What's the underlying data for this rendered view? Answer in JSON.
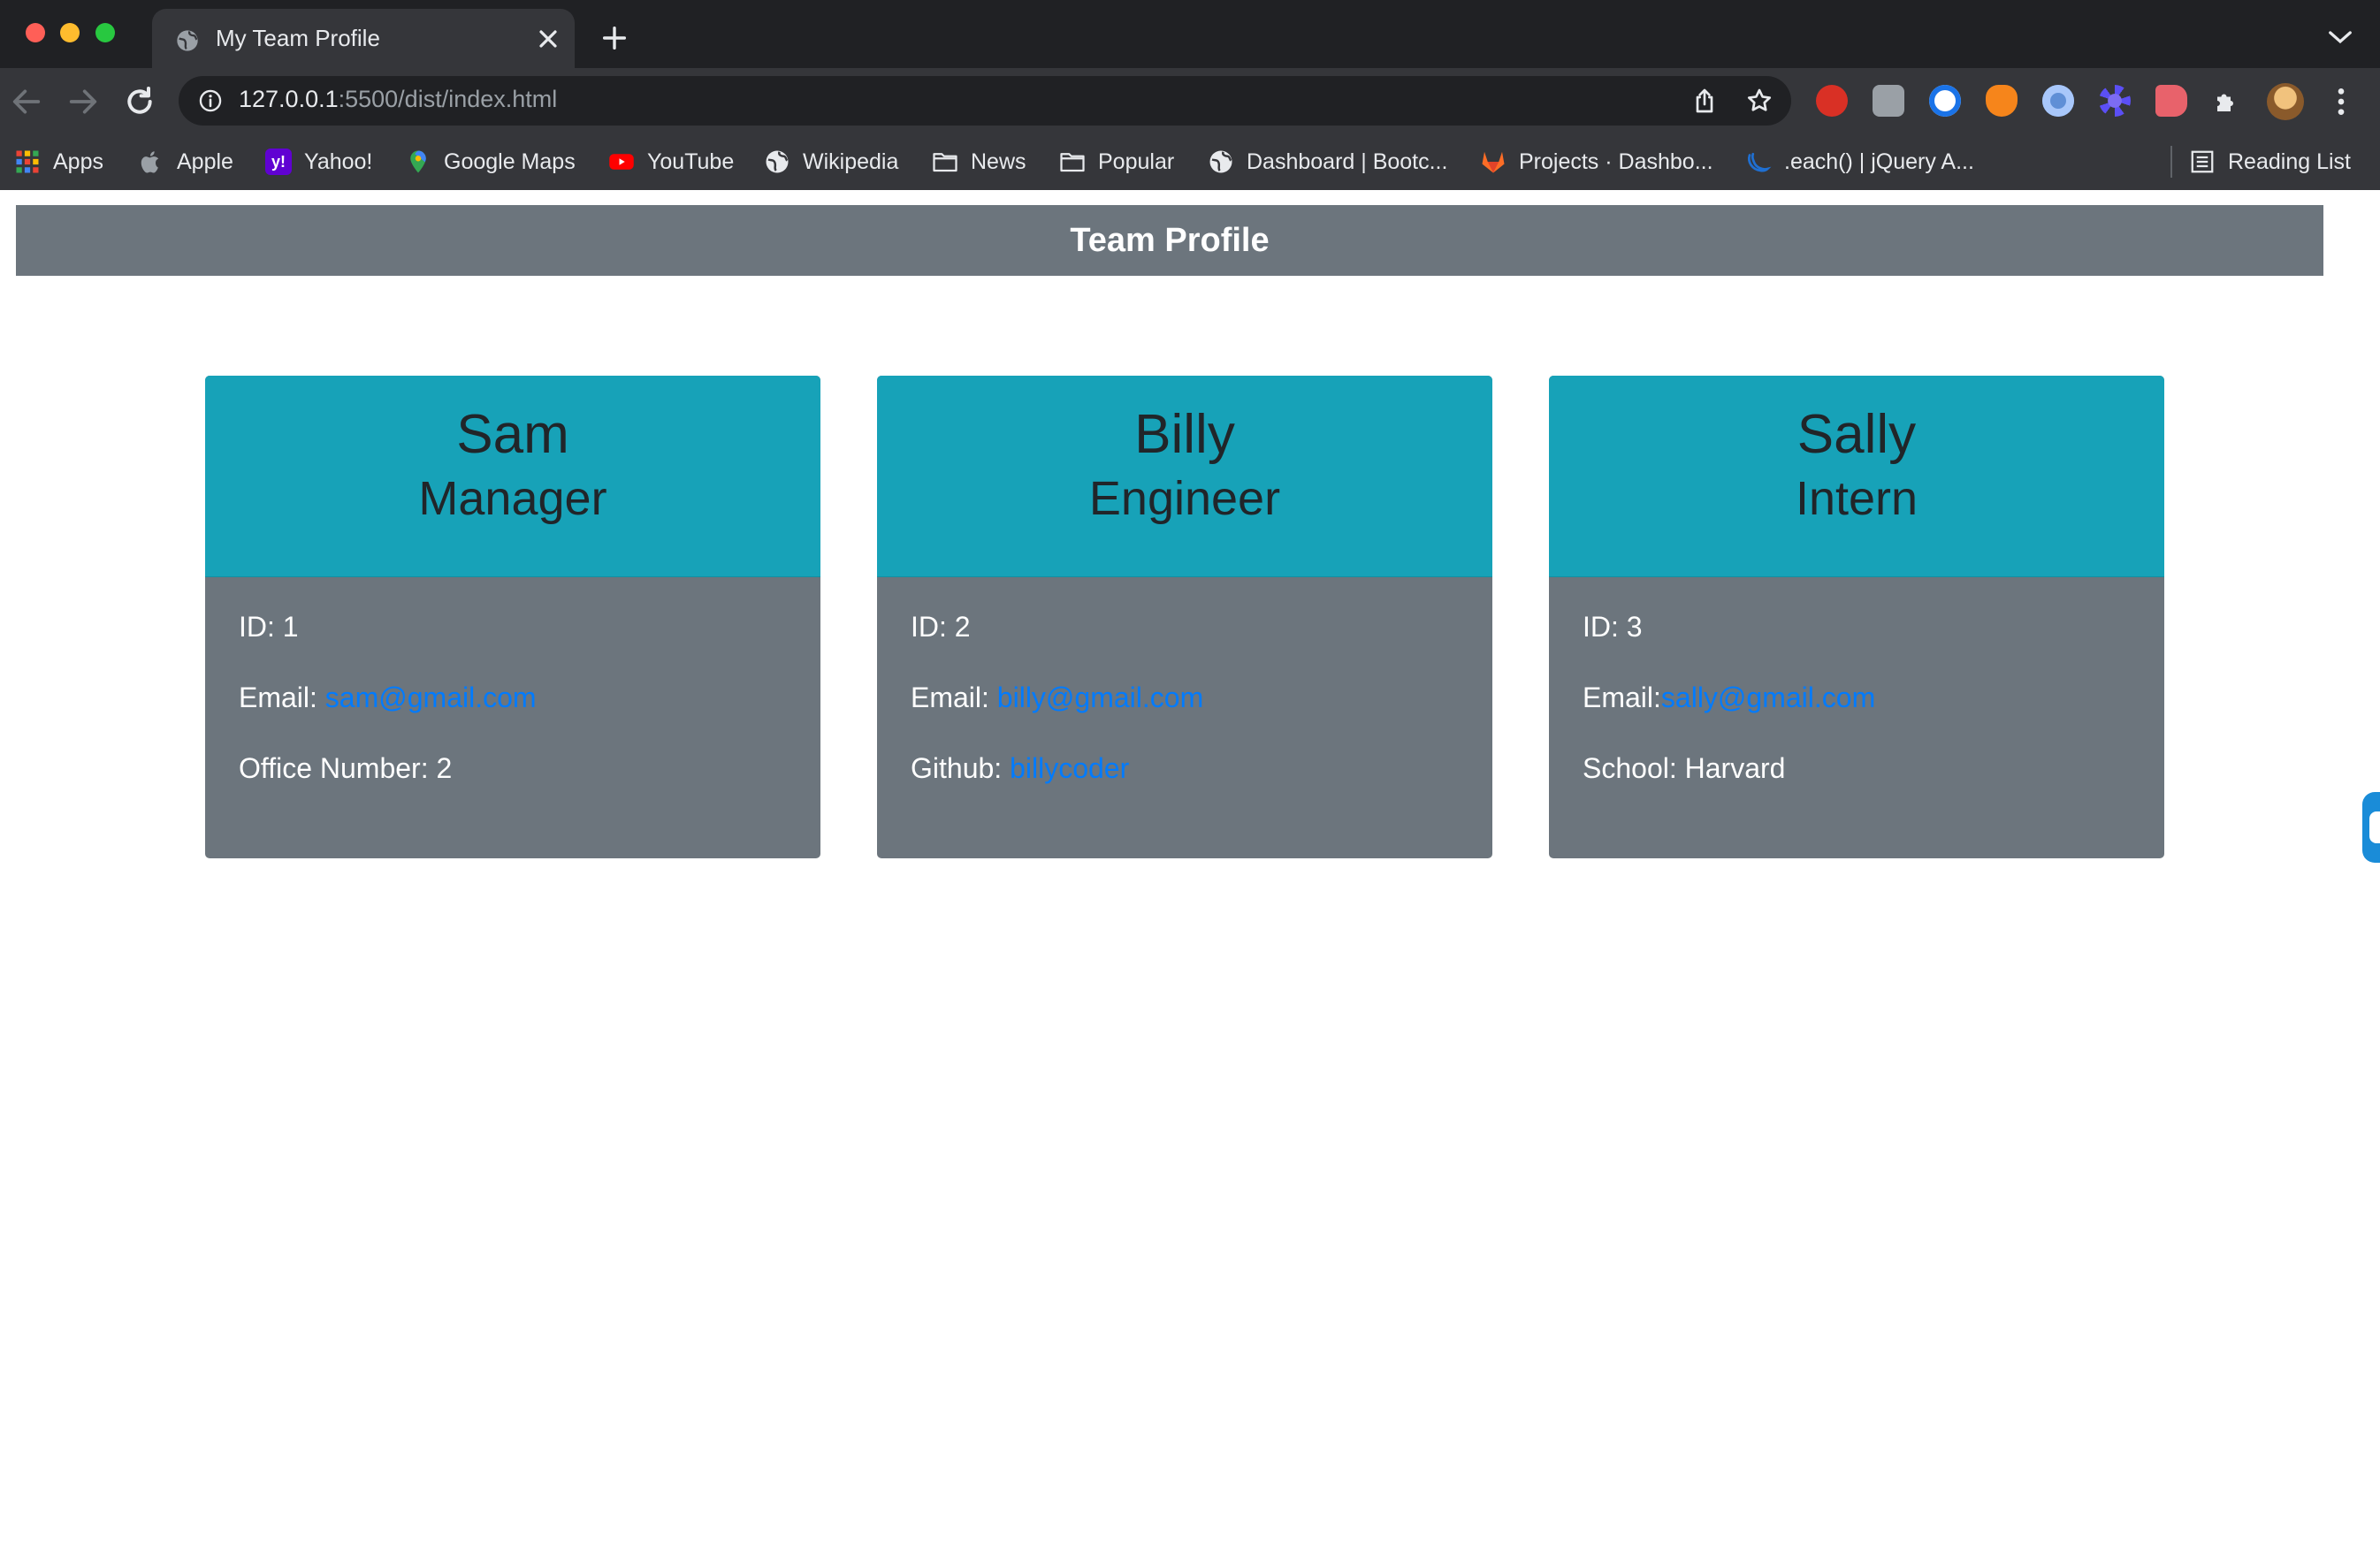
{
  "browser": {
    "tab": {
      "title": "My Team Profile"
    },
    "address_bar": {
      "host": "127.0.0.1",
      "rest": ":5500/dist/index.html"
    },
    "bookmarks": [
      {
        "label": "Apps",
        "icon": "apps-grid-icon"
      },
      {
        "label": "Apple",
        "icon": "apple-icon"
      },
      {
        "label": "Yahoo!",
        "icon": "yahoo-icon"
      },
      {
        "label": "Google Maps",
        "icon": "google-maps-icon"
      },
      {
        "label": "YouTube",
        "icon": "youtube-icon"
      },
      {
        "label": "Wikipedia",
        "icon": "globe-icon"
      },
      {
        "label": "News",
        "icon": "folder-icon"
      },
      {
        "label": "Popular",
        "icon": "folder-icon"
      },
      {
        "label": "Dashboard | Bootc...",
        "icon": "globe-icon"
      },
      {
        "label": "Projects · Dashbo...",
        "icon": "gitlab-icon"
      },
      {
        "label": ".each() | jQuery A...",
        "icon": "jquery-icon"
      }
    ],
    "reading_list": {
      "label": "Reading List",
      "icon": "reading-list-icon"
    }
  },
  "page": {
    "header_title": "Team Profile",
    "employees": [
      {
        "name": "Sam",
        "role": "Manager",
        "id_text": "ID: 1",
        "email_label": "Email: ",
        "email": "sam@gmail.com",
        "extra_label": "Office Number: 2",
        "extra_link": ""
      },
      {
        "name": "Billy",
        "role": "Engineer",
        "id_text": "ID: 2",
        "email_label": "Email: ",
        "email": "billy@gmail.com",
        "extra_label": "Github: ",
        "extra_link": "billycoder"
      },
      {
        "name": "Sally",
        "role": "Intern",
        "id_text": "ID: 3",
        "email_label": "Email:",
        "email": "sally@gmail.com",
        "extra_label": "School: Harvard",
        "extra_link": ""
      }
    ]
  },
  "colors": {
    "header_bg": "#6c757d",
    "card_head_bg": "#17a2b8",
    "card_body_bg": "#6c757d",
    "link": "#007bff"
  }
}
